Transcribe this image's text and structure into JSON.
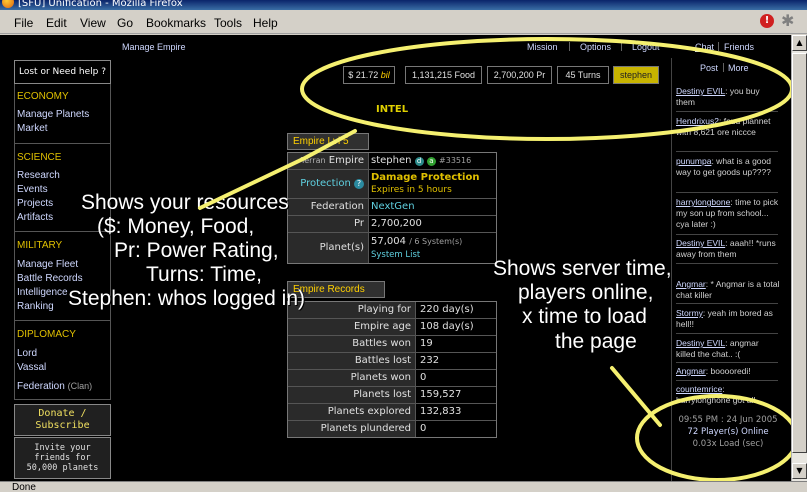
{
  "window": {
    "title": "[SFU] Unification - Mozilla Firefox",
    "status": "Done"
  },
  "menu": [
    "File",
    "Edit",
    "View",
    "Go",
    "Bookmarks",
    "Tools",
    "Help"
  ],
  "topnav": {
    "left": "Manage Empire",
    "links": [
      "Mission",
      "Options",
      "Logout"
    ],
    "chat": "Chat",
    "friends": "Friends"
  },
  "sidebar": {
    "lost": "Lost or Need help ?",
    "sections": [
      {
        "title": "ECONOMY",
        "items": [
          "Manage Planets",
          "Market"
        ]
      },
      {
        "title": "SCIENCE",
        "items": [
          "Research",
          "Events",
          "Projects",
          "Artifacts"
        ]
      },
      {
        "title": "MILITARY",
        "items": [
          "Manage Fleet",
          "Battle Records",
          "Intelligence",
          "Ranking"
        ]
      },
      {
        "title": "DIPLOMACY",
        "items": [
          "Lord",
          "Vassal"
        ]
      }
    ],
    "federation": "Federation",
    "clan": "(Clan)",
    "donate_l1": "Donate /",
    "donate_l2": "Subscribe",
    "invite_l1": "Invite your",
    "invite_l2": "friends for",
    "invite_l3": "50,000 planets"
  },
  "resources": {
    "money": "$ 21.72",
    "money_unit": "bil",
    "food": "1,131,215 Food",
    "power": "2,700,200 Pr",
    "turns": "45 Turns",
    "user": "stephen"
  },
  "intel": "INTEL",
  "empire": {
    "header": "Empire Lvl 5",
    "empire_key_small": "Terran",
    "empire_key": "Empire",
    "empire_val": "stephen",
    "empire_id": "#33516",
    "protection_key": "Protection",
    "protection_val": "Damage Protection",
    "protection_exp": "Expires in 5 hours",
    "federation_key": "Federation",
    "federation_val": "NextGen",
    "pr_key": "Pr",
    "pr_val": "2,700,200",
    "planets_key": "Planet(s)",
    "planets_val": "57,004",
    "planets_sys": "/ 6 System(s)",
    "system_list": "System List"
  },
  "records": {
    "header": "Empire Records",
    "rows": [
      {
        "k": "Playing for",
        "v": "220 day(s)"
      },
      {
        "k": "Empire age",
        "v": "108 day(s)"
      },
      {
        "k": "Battles won",
        "v": "19"
      },
      {
        "k": "Battles lost",
        "v": "232"
      },
      {
        "k": "Planets won",
        "v": "0"
      },
      {
        "k": "Planets lost",
        "v": "159,527"
      },
      {
        "k": "Planets explored",
        "v": "132,833"
      },
      {
        "k": "Planets plundered",
        "v": "0"
      }
    ]
  },
  "chat": {
    "post": "Post",
    "more": "More",
    "messages": [
      {
        "user": "Destiny EVIL",
        "text": ": you buy them"
      },
      {
        "user": "Hendrixus2",
        "text": ": foud plannet with 8,621 ore niccce"
      },
      {
        "user": "punumpa",
        "text": ": what is a good way to get goods up????"
      },
      {
        "user": "harrylongbone",
        "text": ": time to pick my son up from school... cya later :)"
      },
      {
        "user": "Destiny EVIL",
        "text": ": aaah!! *runs away from them"
      },
      {
        "user": "Angmar",
        "text": ": * Angmar is a total chat killer"
      },
      {
        "user": "Stormy",
        "text": ": yeah im bored as hell!!"
      },
      {
        "user": "Destiny EVIL",
        "text": ": angmar killed the chat.. :("
      },
      {
        "user": "Angmar",
        "text": ": booooredi!"
      },
      {
        "user": "countemrice",
        "text": ": harrylonghone got all"
      }
    ],
    "server_time": "09:55 PM : 24 Jun 2005",
    "online": "72 Player(s) Online",
    "load": "0.03x Load (sec)"
  },
  "annotations": {
    "resources": [
      "Shows your resources",
      "($: Money, Food,",
      "Pr: Power Rating,",
      "Turns: Time,",
      "Stephen: whos logged in)"
    ],
    "server": [
      "Shows server time,",
      "players online,",
      "x time to load",
      "the page"
    ]
  }
}
